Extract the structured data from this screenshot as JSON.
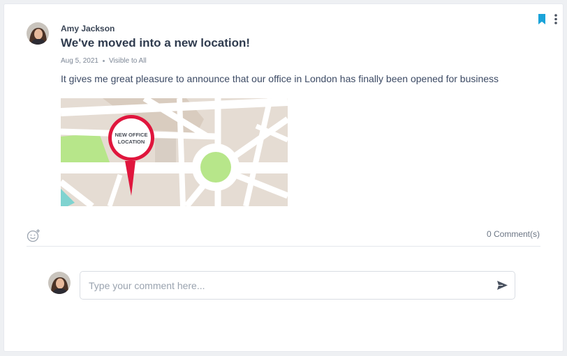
{
  "post": {
    "author": "Amy Jackson",
    "title": "We've moved into a new location!",
    "date": "Aug 5, 2021",
    "visibility": "Visible to All",
    "body": "It gives me great pleasure to announce that our office in London has finally been opened for business",
    "map_pin_label_line1": "NEW OFFICE",
    "map_pin_label_line2": "LOCATION"
  },
  "footer": {
    "comments_count": "0 Comment(s)"
  },
  "comment_input": {
    "placeholder": "Type your comment here..."
  },
  "icons": {
    "bookmark": "bookmark-icon",
    "more": "more-vertical-icon",
    "reaction": "emoji-add-icon",
    "send": "send-icon"
  },
  "colors": {
    "accent": "#1aa3d9",
    "pin": "#e0163d",
    "map_green": "#b7e68a",
    "map_bg": "#e5dcd3",
    "map_road": "#ffffff",
    "map_water": "#7fd3d0"
  }
}
